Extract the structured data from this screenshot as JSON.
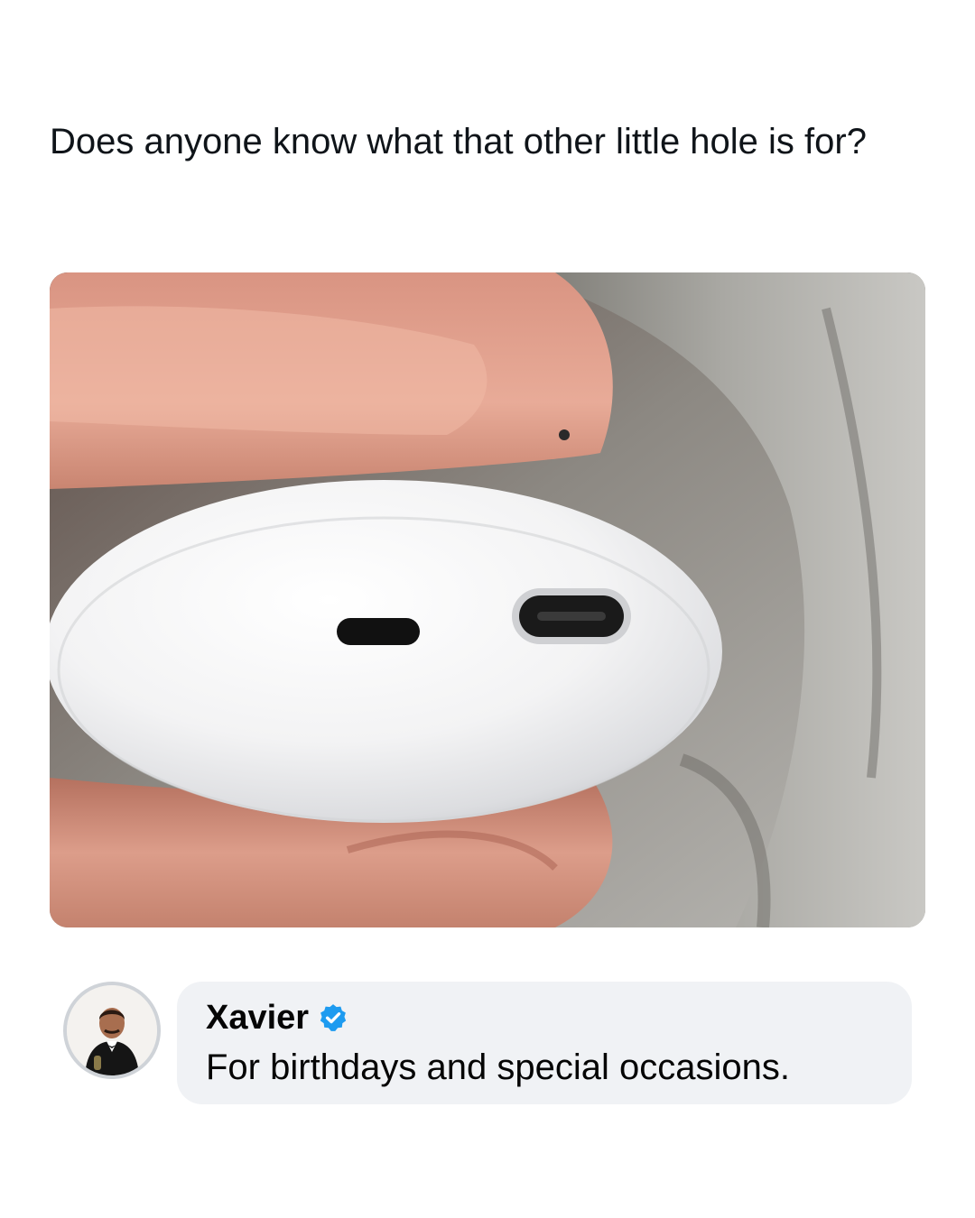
{
  "post": {
    "text": "Does anyone know what that other little hole is for?"
  },
  "media": {
    "icon": "photo-of-white-earbud-case-held-in-fingers"
  },
  "comment": {
    "author": "Xavier",
    "verified_icon": "verified-badge-icon",
    "verified_color": "#1d9bf0",
    "text": "For birthdays and special occasions.",
    "bubble_color": "#f0f2f5"
  }
}
